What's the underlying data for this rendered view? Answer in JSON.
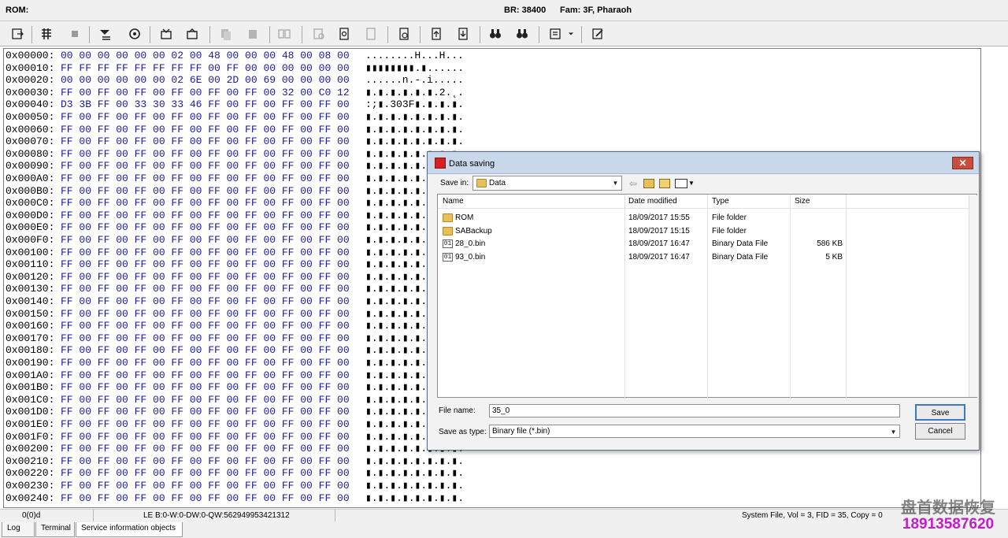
{
  "titlebar": {
    "rom_label": "ROM:",
    "baud": "BR: 38400",
    "family": "Fam: 3F, Pharaoh"
  },
  "toolbar": {
    "icons": [
      "open-icon",
      "hex-view-icon",
      "stop-icon",
      "download-icon",
      "settings-icon",
      "read-icon",
      "write-icon",
      "copy-icon",
      "paste-icon",
      "compare-icon",
      "search-icon",
      "document-icon",
      "export-icon",
      "refresh-icon",
      "prev-icon",
      "next-icon",
      "find-icon",
      "find-next-icon",
      "options-icon",
      "edit-icon"
    ]
  },
  "hexview": {
    "rows": [
      {
        "addr": "0x00000:",
        "bytes": "00 00 00 00 00 00 02 00 48 00 00 00 48 00 08 00",
        "ascii": "........H...H..."
      },
      {
        "addr": "0x00010:",
        "bytes": "FF FF FF FF FF FF FF FF 00 FF 00 00 00 00 00 00",
        "ascii": "▮▮▮▮▮▮▮▮.▮......"
      },
      {
        "addr": "0x00020:",
        "bytes": "00 00 00 00 00 00 02 6E 00 2D 00 69 00 00 00 00",
        "ascii": "......n.-.i....."
      },
      {
        "addr": "0x00030:",
        "bytes": "FF 00 FF 00 FF 00 FF 00 FF 00 FF 00 32 00 C0 12",
        "ascii": "▮.▮.▮.▮.▮.▮.2.˛."
      },
      {
        "addr": "0x00040:",
        "bytes": "D3 3B FF 00 33 30 33 46 FF 00 FF 00 FF 00 FF 00",
        "ascii": ":;▮.303F▮.▮.▮.▮."
      },
      {
        "addr": "0x00050:",
        "bytes": "FF 00 FF 00 FF 00 FF 00 FF 00 FF 00 FF 00 FF 00",
        "ascii": "▮.▮.▮.▮.▮.▮.▮.▮."
      },
      {
        "addr": "0x00060:",
        "bytes": "FF 00 FF 00 FF 00 FF 00 FF 00 FF 00 FF 00 FF 00",
        "ascii": "▮.▮.▮.▮.▮.▮.▮.▮."
      },
      {
        "addr": "0x00070:",
        "bytes": "FF 00 FF 00 FF 00 FF 00 FF 00 FF 00 FF 00 FF 00",
        "ascii": "▮.▮.▮.▮.▮.▮.▮.▮."
      },
      {
        "addr": "0x00080:",
        "bytes": "FF 00 FF 00 FF 00 FF 00 FF 00 FF 00 FF 00 FF 00",
        "ascii": "▮.▮.▮.▮.▮.▮.▮.▮."
      },
      {
        "addr": "0x00090:",
        "bytes": "FF 00 FF 00 FF 00 FF 00 FF 00 FF 00 FF 00 FF 00",
        "ascii": "▮.▮.▮.▮.▮.▮.▮.▮."
      },
      {
        "addr": "0x000A0:",
        "bytes": "FF 00 FF 00 FF 00 FF 00 FF 00 FF 00 FF 00 FF 00",
        "ascii": "▮.▮.▮.▮.▮.▮.▮.▮."
      },
      {
        "addr": "0x000B0:",
        "bytes": "FF 00 FF 00 FF 00 FF 00 FF 00 FF 00 FF 00 FF 00",
        "ascii": "▮.▮.▮.▮.▮.▮.▮.▮."
      },
      {
        "addr": "0x000C0:",
        "bytes": "FF 00 FF 00 FF 00 FF 00 FF 00 FF 00 FF 00 FF 00",
        "ascii": "▮.▮.▮.▮.▮.▮.▮.▮."
      },
      {
        "addr": "0x000D0:",
        "bytes": "FF 00 FF 00 FF 00 FF 00 FF 00 FF 00 FF 00 FF 00",
        "ascii": "▮.▮.▮.▮.▮.▮.▮.▮."
      },
      {
        "addr": "0x000E0:",
        "bytes": "FF 00 FF 00 FF 00 FF 00 FF 00 FF 00 FF 00 FF 00",
        "ascii": "▮.▮.▮.▮.▮.▮.▮.▮."
      },
      {
        "addr": "0x000F0:",
        "bytes": "FF 00 FF 00 FF 00 FF 00 FF 00 FF 00 FF 00 FF 00",
        "ascii": "▮.▮.▮.▮.▮.▮.▮.▮."
      },
      {
        "addr": "0x00100:",
        "bytes": "FF 00 FF 00 FF 00 FF 00 FF 00 FF 00 FF 00 FF 00",
        "ascii": "▮.▮.▮.▮.▮.▮.▮.▮."
      },
      {
        "addr": "0x00110:",
        "bytes": "FF 00 FF 00 FF 00 FF 00 FF 00 FF 00 FF 00 FF 00",
        "ascii": "▮.▮.▮.▮.▮.▮.▮.▮."
      },
      {
        "addr": "0x00120:",
        "bytes": "FF 00 FF 00 FF 00 FF 00 FF 00 FF 00 FF 00 FF 00",
        "ascii": "▮.▮.▮.▮.▮.▮.▮.▮."
      },
      {
        "addr": "0x00130:",
        "bytes": "FF 00 FF 00 FF 00 FF 00 FF 00 FF 00 FF 00 FF 00",
        "ascii": "▮.▮.▮.▮.▮.▮.▮.▮."
      },
      {
        "addr": "0x00140:",
        "bytes": "FF 00 FF 00 FF 00 FF 00 FF 00 FF 00 FF 00 FF 00",
        "ascii": "▮.▮.▮.▮.▮.▮.▮.▮."
      },
      {
        "addr": "0x00150:",
        "bytes": "FF 00 FF 00 FF 00 FF 00 FF 00 FF 00 FF 00 FF 00",
        "ascii": "▮.▮.▮.▮.▮.▮.▮.▮."
      },
      {
        "addr": "0x00160:",
        "bytes": "FF 00 FF 00 FF 00 FF 00 FF 00 FF 00 FF 00 FF 00",
        "ascii": "▮.▮.▮.▮.▮.▮.▮.▮."
      },
      {
        "addr": "0x00170:",
        "bytes": "FF 00 FF 00 FF 00 FF 00 FF 00 FF 00 FF 00 FF 00",
        "ascii": "▮.▮.▮.▮.▮.▮.▮.▮."
      },
      {
        "addr": "0x00180:",
        "bytes": "FF 00 FF 00 FF 00 FF 00 FF 00 FF 00 FF 00 FF 00",
        "ascii": "▮.▮.▮.▮.▮.▮.▮.▮."
      },
      {
        "addr": "0x00190:",
        "bytes": "FF 00 FF 00 FF 00 FF 00 FF 00 FF 00 FF 00 FF 00",
        "ascii": "▮.▮.▮.▮.▮.▮.▮.▮."
      },
      {
        "addr": "0x001A0:",
        "bytes": "FF 00 FF 00 FF 00 FF 00 FF 00 FF 00 FF 00 FF 00",
        "ascii": "▮.▮.▮.▮.▮.▮.▮.▮."
      },
      {
        "addr": "0x001B0:",
        "bytes": "FF 00 FF 00 FF 00 FF 00 FF 00 FF 00 FF 00 FF 00",
        "ascii": "▮.▮.▮.▮.▮.▮.▮.▮."
      },
      {
        "addr": "0x001C0:",
        "bytes": "FF 00 FF 00 FF 00 FF 00 FF 00 FF 00 FF 00 FF 00",
        "ascii": "▮.▮.▮.▮.▮.▮.▮.▮."
      },
      {
        "addr": "0x001D0:",
        "bytes": "FF 00 FF 00 FF 00 FF 00 FF 00 FF 00 FF 00 FF 00",
        "ascii": "▮.▮.▮.▮.▮.▮.▮.▮."
      },
      {
        "addr": "0x001E0:",
        "bytes": "FF 00 FF 00 FF 00 FF 00 FF 00 FF 00 FF 00 FF 00",
        "ascii": "▮.▮.▮.▮.▮.▮.▮.▮."
      },
      {
        "addr": "0x001F0:",
        "bytes": "FF 00 FF 00 FF 00 FF 00 FF 00 FF 00 FF 00 FF 00",
        "ascii": "▮.▮.▮.▮.▮.▮.▮.▮."
      },
      {
        "addr": "0x00200:",
        "bytes": "FF 00 FF 00 FF 00 FF 00 FF 00 FF 00 FF 00 FF 00",
        "ascii": "▮.▮.▮.▮.▮.▮.▮.▮."
      },
      {
        "addr": "0x00210:",
        "bytes": "FF 00 FF 00 FF 00 FF 00 FF 00 FF 00 FF 00 FF 00",
        "ascii": "▮.▮.▮.▮.▮.▮.▮.▮."
      },
      {
        "addr": "0x00220:",
        "bytes": "FF 00 FF 00 FF 00 FF 00 FF 00 FF 00 FF 00 FF 00",
        "ascii": "▮.▮.▮.▮.▮.▮.▮.▮."
      },
      {
        "addr": "0x00230:",
        "bytes": "FF 00 FF 00 FF 00 FF 00 FF 00 FF 00 FF 00 FF 00",
        "ascii": "▮.▮.▮.▮.▮.▮.▮.▮."
      },
      {
        "addr": "0x00240:",
        "bytes": "FF 00 FF 00 FF 00 FF 00 FF 00 FF 00 FF 00 FF 00",
        "ascii": "▮.▮.▮.▮.▮.▮.▮.▮."
      }
    ]
  },
  "statusbar": {
    "position": "0(0)d",
    "values": "LE B:0-W:0-DW:0-QW:562949953421312",
    "file_info": "System File, Vol = 3, FID = 35, Copy = 0"
  },
  "tabs": [
    {
      "label": "Log"
    },
    {
      "label": "Terminal"
    },
    {
      "label": "Service information objects"
    }
  ],
  "dialog": {
    "title": "Data saving",
    "close_label": "✕",
    "save_in_label": "Save in:",
    "save_in_value": "Data",
    "columns": {
      "name": "Name",
      "date": "Date modified",
      "type": "Type",
      "size": "Size"
    },
    "files": [
      {
        "name": "ROM",
        "date": "18/09/2017 15:55",
        "type": "File folder",
        "size": "",
        "icon": "folder-icon"
      },
      {
        "name": "SABackup",
        "date": "18/09/2017 15:15",
        "type": "File folder",
        "size": "",
        "icon": "folder-icon"
      },
      {
        "name": "28_0.bin",
        "date": "18/09/2017 16:47",
        "type": "Binary Data File",
        "size": "586 KB",
        "icon": "binary-file-icon"
      },
      {
        "name": "93_0.bin",
        "date": "18/09/2017 16:47",
        "type": "Binary Data File",
        "size": "5 KB",
        "icon": "binary-file-icon"
      }
    ],
    "file_name_label": "File name:",
    "file_name_value": "35_0",
    "save_as_type_label": "Save as type:",
    "save_as_type_value": "Binary file (*.bin)",
    "save_label": "Save",
    "cancel_label": "Cancel"
  },
  "watermark": {
    "line1": "盘首数据恢复",
    "line2": "18913587620"
  },
  "colors": {
    "bytes": "#1a1aa0",
    "dialog_title": "#c9d7ea",
    "close": "#c94c3c",
    "watermark": "#c020c8"
  }
}
